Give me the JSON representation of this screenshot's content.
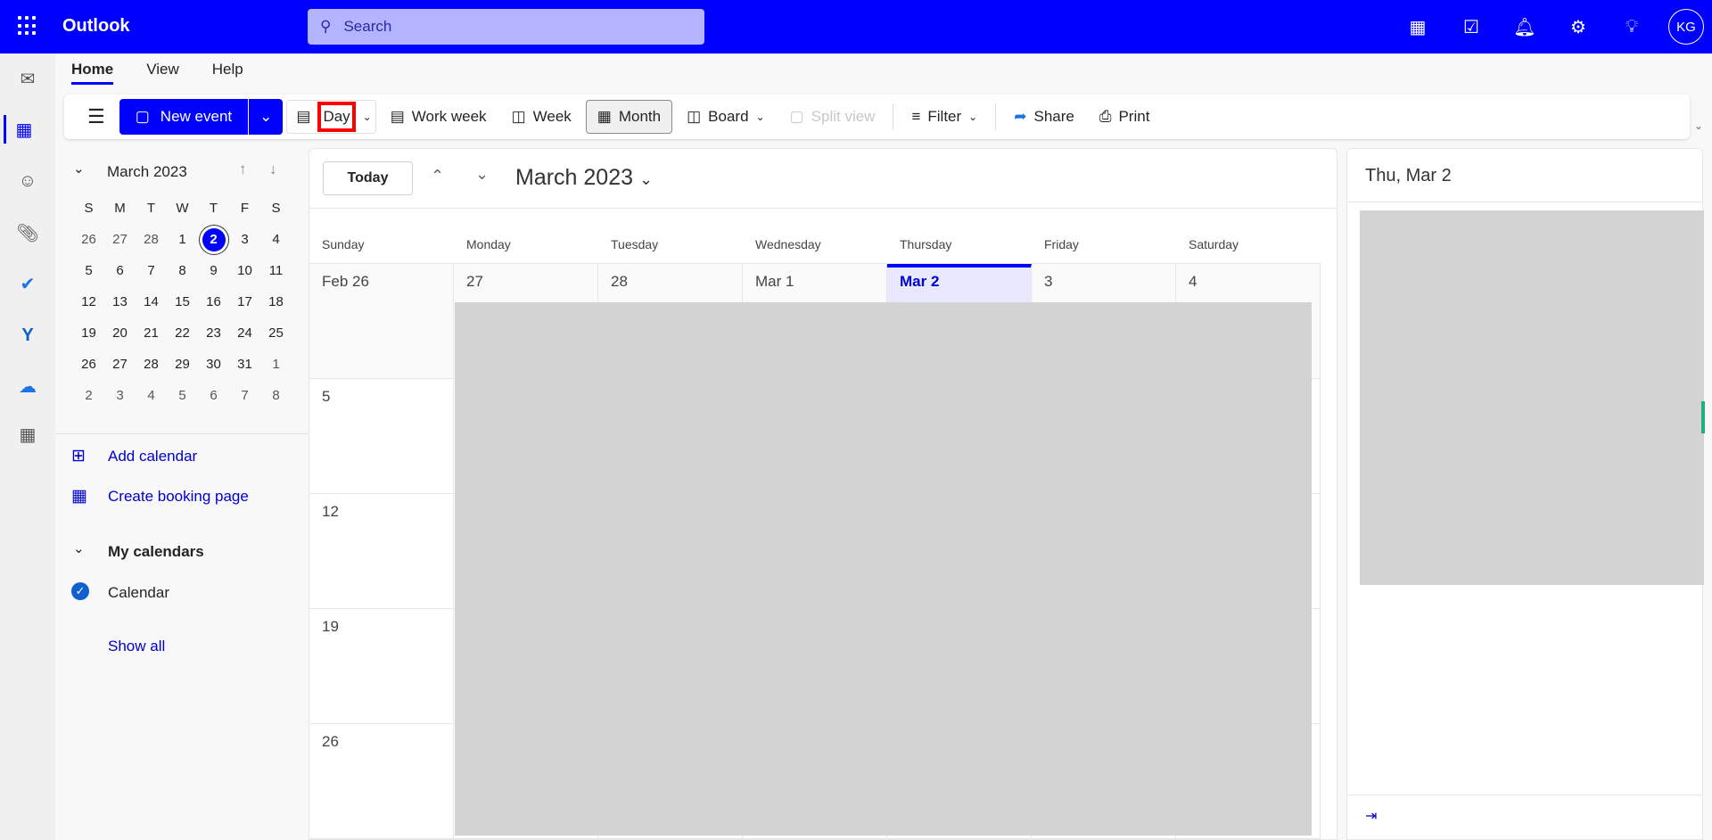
{
  "app": {
    "title": "Outlook",
    "search_placeholder": "Search",
    "avatar_initials": "KG",
    "top_icons": [
      "onenote-icon",
      "my-day-icon",
      "bell-icon",
      "gear-icon",
      "lightbulb-icon"
    ],
    "accent": "#0000ff"
  },
  "rail": [
    "mail-icon",
    "calendar-icon",
    "people-icon",
    "attachment-icon",
    "todo-icon",
    "yammer-icon",
    "onedrive-icon",
    "apps-icon"
  ],
  "tabs": [
    {
      "label": "Home",
      "active": true
    },
    {
      "label": "View"
    },
    {
      "label": "Help"
    }
  ],
  "toolbar": {
    "new_event": "New event",
    "day": "Day",
    "work_week": "Work week",
    "week": "Week",
    "month": "Month",
    "board": "Board",
    "split_view": "Split view",
    "filter": "Filter",
    "share": "Share",
    "print": "Print"
  },
  "mini_calendar": {
    "title": "March 2023",
    "weekdays": [
      "S",
      "M",
      "T",
      "W",
      "T",
      "F",
      "S"
    ],
    "days": [
      "26",
      "27",
      "28",
      "1",
      "2",
      "3",
      "4",
      "5",
      "6",
      "7",
      "8",
      "9",
      "10",
      "11",
      "12",
      "13",
      "14",
      "15",
      "16",
      "17",
      "18",
      "19",
      "20",
      "21",
      "22",
      "23",
      "24",
      "25",
      "26",
      "27",
      "28",
      "29",
      "30",
      "31",
      "1",
      "2",
      "3",
      "4",
      "5",
      "6",
      "7",
      "8"
    ],
    "selected": "2"
  },
  "sidebar": {
    "add_calendar": "Add calendar",
    "create_booking": "Create booking page",
    "my_calendars": "My calendars",
    "calendar": "Calendar",
    "show_all": "Show all"
  },
  "main": {
    "today": "Today",
    "title": "March 2023",
    "weekdays": [
      "Sunday",
      "Monday",
      "Tuesday",
      "Wednesday",
      "Thursday",
      "Friday",
      "Saturday"
    ],
    "week_labels": [
      [
        "Feb 26",
        "27",
        "28",
        "Mar 1",
        "Mar 2",
        "3",
        "4"
      ],
      [
        "5",
        "",
        "",
        "",
        "",
        "",
        ""
      ],
      [
        "12",
        "",
        "",
        "",
        "",
        "",
        ""
      ],
      [
        "19",
        "",
        "",
        "",
        "",
        "",
        ""
      ],
      [
        "26",
        "",
        "",
        "",
        "",
        "",
        ""
      ]
    ],
    "today_label": "Mar 2"
  },
  "right_panel": {
    "title": "Thu, Mar 2"
  }
}
